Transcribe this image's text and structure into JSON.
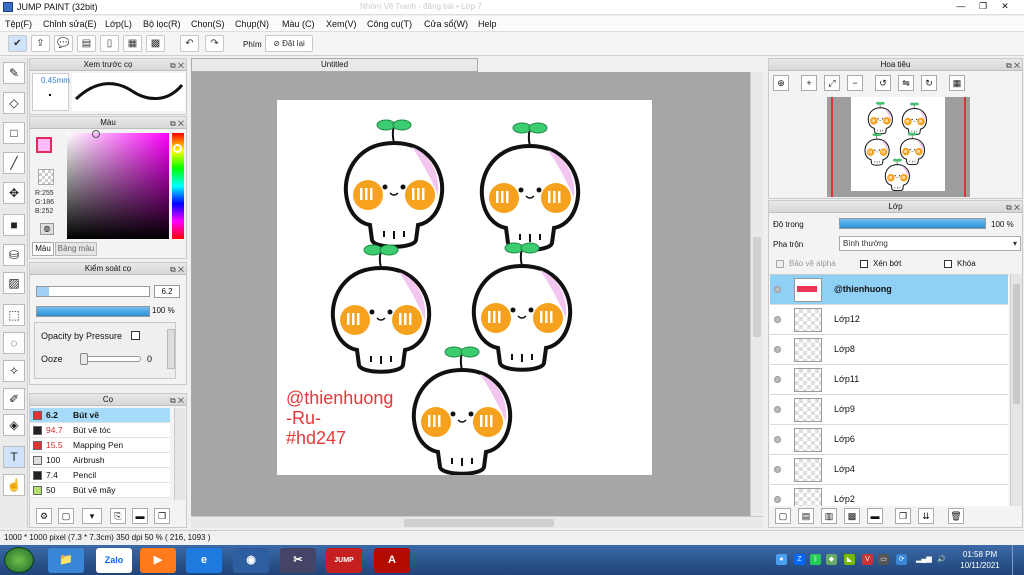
{
  "window": {
    "title": "JUMP PAINT (32bit)",
    "ghost_title": "Nhóm Vẽ Tranh - đăng bài • Lớp 7"
  },
  "menu": [
    "Tệp(F)",
    "Chỉnh sửa(E)",
    "Lớp(L)",
    "Bộ lọc(R)",
    "Chọn(S)",
    "Chụp(N)",
    "Màu (C)",
    "Xem(V)",
    "Công cụ(T)",
    "Cửa sổ(W)",
    "Help"
  ],
  "toolbar": {
    "phim_label": "Phím",
    "reset_label": "Đặt lại"
  },
  "preview_panel": {
    "title": "Xem trước cọ",
    "size": "0.45mm"
  },
  "color_panel": {
    "title": "Màu",
    "r": "R:255",
    "g": "G:186",
    "b": "B:252",
    "tab_color": "Màu",
    "tab_palette": "Bảng màu",
    "fg_color": "#ffbafc"
  },
  "brush_control": {
    "title": "Kiểm soát cọ",
    "size_value": "6.2",
    "opacity_value": "100 %",
    "opacity_pressure_label": "Opacity by Pressure",
    "ooze_label": "Ooze",
    "ooze_value": "0"
  },
  "brush_panel": {
    "title": "Cọ",
    "items": [
      {
        "size": "6.2",
        "name": "Bút vẽ",
        "color": "#e83030",
        "selected": true
      },
      {
        "size": "94.7",
        "name": "Bút vẽ tóc",
        "color": "#222222",
        "selected": false
      },
      {
        "size": "15.5",
        "name": "Mapping Pen",
        "color": "#e83030",
        "selected": false
      },
      {
        "size": "100",
        "name": "Airbrush",
        "color": "#dddddd",
        "selected": false
      },
      {
        "size": "7.4",
        "name": "Pencil",
        "color": "#222222",
        "selected": false
      },
      {
        "size": "50",
        "name": "Bút vẽ mây",
        "color": "#b5e36a",
        "selected": false
      }
    ]
  },
  "document": {
    "tab_title": "Untitled",
    "watermark_line1": "@thienhuong",
    "watermark_line2": "-Ru-",
    "watermark_line3": "#hd247"
  },
  "navigator": {
    "title": "Hoa tiêu"
  },
  "layer_panel": {
    "title": "Lớp",
    "opacity_label": "Độ trong",
    "opacity_value": "100 %",
    "blend_label": "Pha trộn",
    "blend_value": "Bình thường",
    "protect_alpha": "Bảo vệ alpha",
    "clip_label": "Xén bớt",
    "lock_label": "Khóa",
    "layers": [
      "@thienhuong",
      "Lớp12",
      "Lớp8",
      "Lớp11",
      "Lớp9",
      "Lớp6",
      "Lớp4",
      "Lớp2"
    ]
  },
  "status": {
    "text": "1000 * 1000 pixel  (7.3 * 7.3cm)  350 dpi  50 %  ( 216, 1093 )"
  },
  "taskbar": {
    "time": "01:58 PM",
    "date": "10/11/2021",
    "zalo_label": "Zalo",
    "jump_label": "JUMP"
  }
}
